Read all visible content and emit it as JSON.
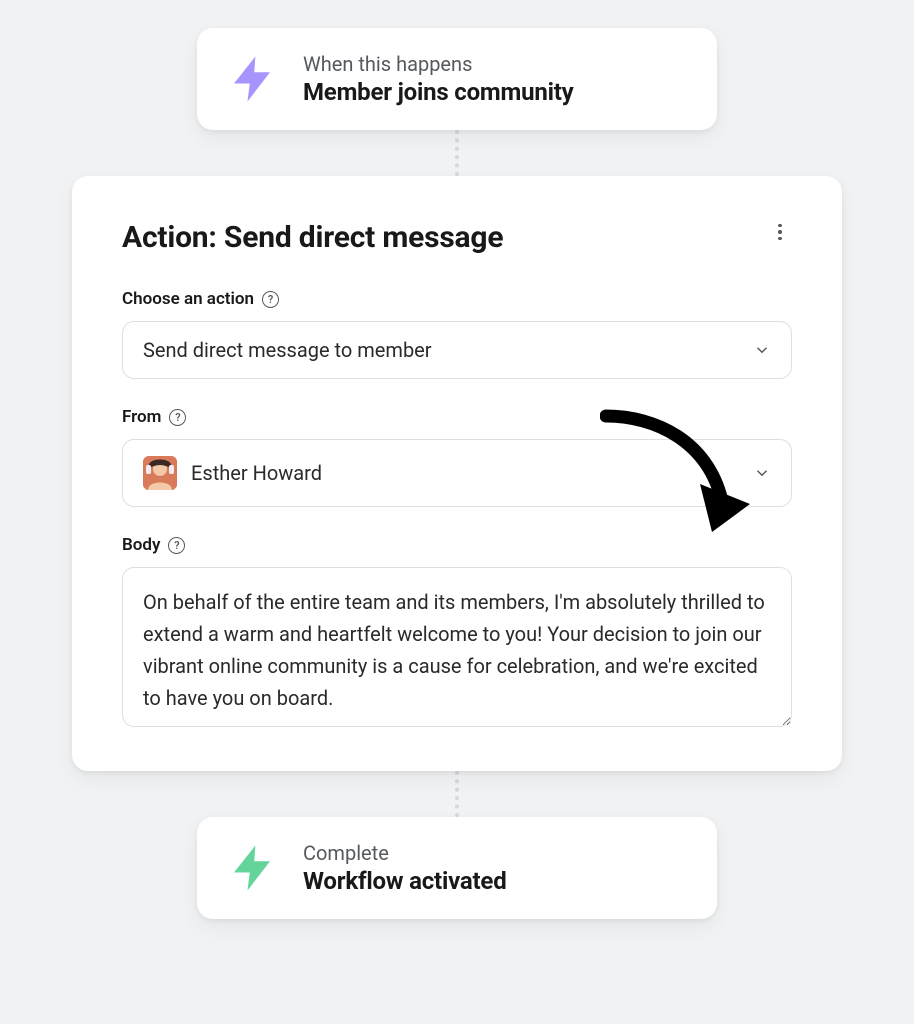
{
  "trigger": {
    "line1": "When this happens",
    "line2": "Member joins community"
  },
  "action": {
    "title": "Action: Send direct message",
    "choose_label": "Choose an action",
    "choose_value": "Send direct message to member",
    "from_label": "From",
    "from_value": "Esther Howard",
    "body_label": "Body",
    "body_value": "On behalf of the entire team and its members, I'm absolutely thrilled to extend a warm and heartfelt welcome to you! Your decision to join our vibrant online community is a cause for celebration, and we're excited to have you on board."
  },
  "complete": {
    "line1": "Complete",
    "line2": "Workflow activated"
  }
}
